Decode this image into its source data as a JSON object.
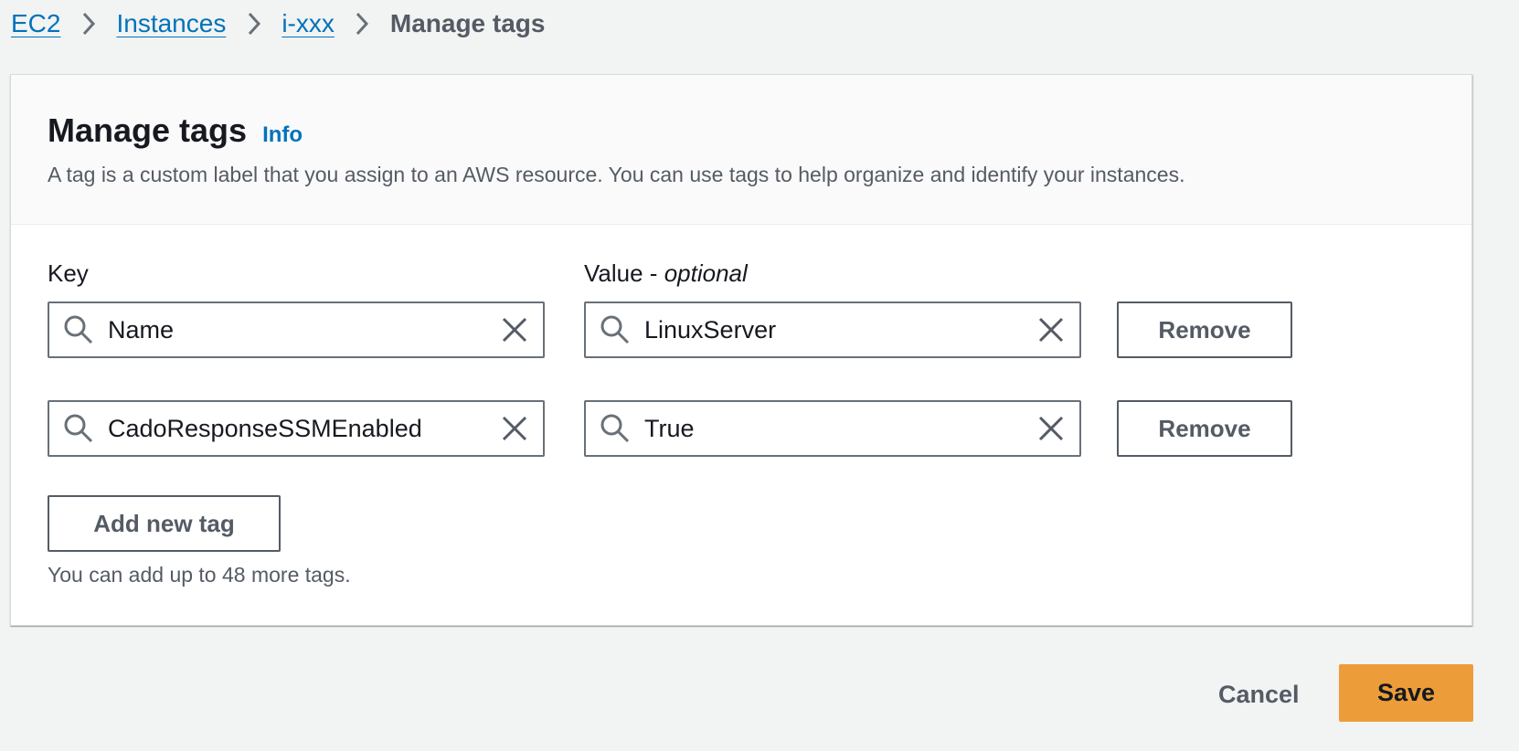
{
  "breadcrumb": {
    "items": [
      {
        "label": "EC2"
      },
      {
        "label": "Instances"
      },
      {
        "label": "i-xxx"
      }
    ],
    "current": "Manage tags",
    "separator_icon": "chevron-right-icon"
  },
  "panel": {
    "title": "Manage tags",
    "info_label": "Info",
    "description": "A tag is a custom label that you assign to an AWS resource. You can use tags to help organize and identify your instances."
  },
  "fields": {
    "key_label": "Key",
    "value_label": "Value - ",
    "value_optional": "optional"
  },
  "tags": [
    {
      "key": "Name",
      "value": "LinuxServer",
      "remove_label": "Remove"
    },
    {
      "key": "CadoResponseSSMEnabled",
      "value": "True",
      "remove_label": "Remove"
    }
  ],
  "add_tag_label": "Add new tag",
  "hint": "You can add up to 48 more tags.",
  "footer": {
    "cancel_label": "Cancel",
    "save_label": "Save"
  },
  "colors": {
    "link": "#0073bb",
    "primary_button": "#ec9d3a",
    "background": "#f2f3f3"
  }
}
